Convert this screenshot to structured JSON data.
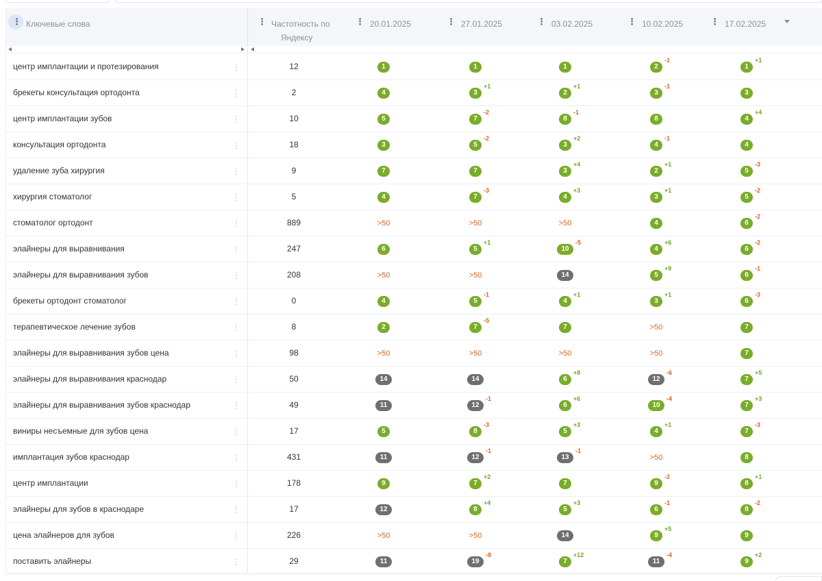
{
  "header": {
    "keywords_label": "Ключевые слова",
    "frequency_label_line1": "Частотность по",
    "frequency_label_line2": "Яндексу",
    "dates": [
      "20.01.2025",
      "27.01.2025",
      "03.02.2025",
      "10.02.2025",
      "17.02.2025"
    ]
  },
  "icons": {
    "column_menu": "vertical-dots-icon",
    "row_menu": "vertical-dots-icon",
    "sort": "caret-down-icon",
    "scroll_left": "triangle-left-icon",
    "scroll_right": "triangle-right-icon"
  },
  "colors": {
    "top_position": "#7aac2a",
    "low_position": "#6f6f6f",
    "out_of_range": "#d9631f",
    "delta_up": "#6ea52a",
    "delta_down": "#d9631f"
  },
  "rows": [
    {
      "keyword": "центр имплантации и протезирования",
      "frequency": "12",
      "positions": [
        {
          "v": "1",
          "t": "g",
          "d": ""
        },
        {
          "v": "1",
          "t": "g",
          "d": ""
        },
        {
          "v": "1",
          "t": "g",
          "d": ""
        },
        {
          "v": "2",
          "t": "g",
          "d": "-1"
        },
        {
          "v": "1",
          "t": "g",
          "d": "+1"
        }
      ]
    },
    {
      "keyword": "брекеты консультация ортодонта",
      "frequency": "2",
      "positions": [
        {
          "v": "4",
          "t": "g",
          "d": ""
        },
        {
          "v": "3",
          "t": "g",
          "d": "+1"
        },
        {
          "v": "2",
          "t": "g",
          "d": "+1"
        },
        {
          "v": "3",
          "t": "g",
          "d": "-1"
        },
        {
          "v": "3",
          "t": "g",
          "d": ""
        }
      ]
    },
    {
      "keyword": "центр имплантации зубов",
      "frequency": "10",
      "positions": [
        {
          "v": "5",
          "t": "g",
          "d": ""
        },
        {
          "v": "7",
          "t": "g",
          "d": "-2"
        },
        {
          "v": "8",
          "t": "g",
          "d": "-1"
        },
        {
          "v": "8",
          "t": "g",
          "d": ""
        },
        {
          "v": "4",
          "t": "g",
          "d": "+4"
        }
      ]
    },
    {
      "keyword": "консультация ортодонта",
      "frequency": "18",
      "positions": [
        {
          "v": "3",
          "t": "g",
          "d": ""
        },
        {
          "v": "5",
          "t": "g",
          "d": "-2"
        },
        {
          "v": "3",
          "t": "g",
          "d": "+2"
        },
        {
          "v": "4",
          "t": "g",
          "d": "-1"
        },
        {
          "v": "4",
          "t": "g",
          "d": ""
        }
      ]
    },
    {
      "keyword": "удаление зуба хирургия",
      "frequency": "9",
      "positions": [
        {
          "v": "7",
          "t": "g",
          "d": ""
        },
        {
          "v": "7",
          "t": "g",
          "d": ""
        },
        {
          "v": "3",
          "t": "g",
          "d": "+4"
        },
        {
          "v": "2",
          "t": "g",
          "d": "+1"
        },
        {
          "v": "5",
          "t": "g",
          "d": "-3"
        }
      ]
    },
    {
      "keyword": "хирургия стоматолог",
      "frequency": "5",
      "positions": [
        {
          "v": "4",
          "t": "g",
          "d": ""
        },
        {
          "v": "7",
          "t": "g",
          "d": "-3"
        },
        {
          "v": "4",
          "t": "g",
          "d": "+3"
        },
        {
          "v": "3",
          "t": "g",
          "d": "+1"
        },
        {
          "v": "5",
          "t": "g",
          "d": "-2"
        }
      ]
    },
    {
      "keyword": "стоматолог ортодонт",
      "frequency": "889",
      "positions": [
        {
          "v": ">50",
          "t": "o",
          "d": ""
        },
        {
          "v": ">50",
          "t": "o",
          "d": ""
        },
        {
          "v": ">50",
          "t": "o",
          "d": ""
        },
        {
          "v": "4",
          "t": "g",
          "d": ""
        },
        {
          "v": "6",
          "t": "g",
          "d": "-2"
        }
      ]
    },
    {
      "keyword": "элайнеры для выравнивания",
      "frequency": "247",
      "positions": [
        {
          "v": "6",
          "t": "g",
          "d": ""
        },
        {
          "v": "5",
          "t": "g",
          "d": "+1"
        },
        {
          "v": "10",
          "t": "g",
          "d": "-5"
        },
        {
          "v": "4",
          "t": "g",
          "d": "+6"
        },
        {
          "v": "6",
          "t": "g",
          "d": "-2"
        }
      ]
    },
    {
      "keyword": "элайнеры для выравнивания зубов",
      "frequency": "208",
      "positions": [
        {
          "v": ">50",
          "t": "o",
          "d": ""
        },
        {
          "v": ">50",
          "t": "o",
          "d": ""
        },
        {
          "v": "14",
          "t": "x",
          "d": ""
        },
        {
          "v": "5",
          "t": "g",
          "d": "+9"
        },
        {
          "v": "6",
          "t": "g",
          "d": "-1"
        }
      ]
    },
    {
      "keyword": "брекеты ортодонт стоматолог",
      "frequency": "0",
      "positions": [
        {
          "v": "4",
          "t": "g",
          "d": ""
        },
        {
          "v": "5",
          "t": "g",
          "d": "-1"
        },
        {
          "v": "4",
          "t": "g",
          "d": "+1"
        },
        {
          "v": "3",
          "t": "g",
          "d": "+1"
        },
        {
          "v": "6",
          "t": "g",
          "d": "-3"
        }
      ]
    },
    {
      "keyword": "терапевтическое лечение зубов",
      "frequency": "8",
      "positions": [
        {
          "v": "2",
          "t": "g",
          "d": ""
        },
        {
          "v": "7",
          "t": "g",
          "d": "-5"
        },
        {
          "v": "7",
          "t": "g",
          "d": ""
        },
        {
          "v": ">50",
          "t": "o",
          "d": ""
        },
        {
          "v": "7",
          "t": "g",
          "d": ""
        }
      ]
    },
    {
      "keyword": "элайнеры для выравнивания зубов цена",
      "frequency": "98",
      "positions": [
        {
          "v": ">50",
          "t": "o",
          "d": ""
        },
        {
          "v": ">50",
          "t": "o",
          "d": ""
        },
        {
          "v": ">50",
          "t": "o",
          "d": ""
        },
        {
          "v": ">50",
          "t": "o",
          "d": ""
        },
        {
          "v": "7",
          "t": "g",
          "d": ""
        }
      ]
    },
    {
      "keyword": "элайнеры для выравнивания краснодар",
      "frequency": "50",
      "positions": [
        {
          "v": "14",
          "t": "x",
          "d": ""
        },
        {
          "v": "14",
          "t": "x",
          "d": ""
        },
        {
          "v": "6",
          "t": "g",
          "d": "+8"
        },
        {
          "v": "12",
          "t": "x",
          "d": "-6"
        },
        {
          "v": "7",
          "t": "g",
          "d": "+5"
        }
      ]
    },
    {
      "keyword": "элайнеры для выравнивания зубов краснодар",
      "frequency": "49",
      "positions": [
        {
          "v": "11",
          "t": "x",
          "d": ""
        },
        {
          "v": "12",
          "t": "x",
          "d": "-1"
        },
        {
          "v": "6",
          "t": "g",
          "d": "+6"
        },
        {
          "v": "10",
          "t": "g",
          "d": "-4"
        },
        {
          "v": "7",
          "t": "g",
          "d": "+3"
        }
      ]
    },
    {
      "keyword": "виниры несъемные для зубов цена",
      "frequency": "17",
      "positions": [
        {
          "v": "5",
          "t": "g",
          "d": ""
        },
        {
          "v": "8",
          "t": "g",
          "d": "-3"
        },
        {
          "v": "5",
          "t": "g",
          "d": "+3"
        },
        {
          "v": "4",
          "t": "g",
          "d": "+1"
        },
        {
          "v": "7",
          "t": "g",
          "d": "-3"
        }
      ]
    },
    {
      "keyword": "имплантация зубов краснодар",
      "frequency": "431",
      "positions": [
        {
          "v": "11",
          "t": "x",
          "d": ""
        },
        {
          "v": "12",
          "t": "x",
          "d": "-1"
        },
        {
          "v": "13",
          "t": "x",
          "d": "-1"
        },
        {
          "v": ">50",
          "t": "o",
          "d": ""
        },
        {
          "v": "8",
          "t": "g",
          "d": ""
        }
      ]
    },
    {
      "keyword": "центр имплантации",
      "frequency": "178",
      "positions": [
        {
          "v": "9",
          "t": "g",
          "d": ""
        },
        {
          "v": "7",
          "t": "g",
          "d": "+2"
        },
        {
          "v": "7",
          "t": "g",
          "d": ""
        },
        {
          "v": "9",
          "t": "g",
          "d": "-2"
        },
        {
          "v": "8",
          "t": "g",
          "d": "+1"
        }
      ]
    },
    {
      "keyword": "элайнеры для зубов в краснодаре",
      "frequency": "17",
      "positions": [
        {
          "v": "12",
          "t": "x",
          "d": ""
        },
        {
          "v": "8",
          "t": "g",
          "d": "+4"
        },
        {
          "v": "5",
          "t": "g",
          "d": "+3"
        },
        {
          "v": "6",
          "t": "g",
          "d": "-1"
        },
        {
          "v": "8",
          "t": "g",
          "d": "-2"
        }
      ]
    },
    {
      "keyword": "цена элайнеров для зубов",
      "frequency": "226",
      "positions": [
        {
          "v": ">50",
          "t": "o",
          "d": ""
        },
        {
          "v": ">50",
          "t": "o",
          "d": ""
        },
        {
          "v": "14",
          "t": "x",
          "d": ""
        },
        {
          "v": "9",
          "t": "g",
          "d": "+5"
        },
        {
          "v": "9",
          "t": "g",
          "d": ""
        }
      ]
    },
    {
      "keyword": "поставить элайнеры",
      "frequency": "29",
      "positions": [
        {
          "v": "11",
          "t": "x",
          "d": ""
        },
        {
          "v": "19",
          "t": "x",
          "d": "-8"
        },
        {
          "v": "7",
          "t": "g",
          "d": "+12"
        },
        {
          "v": "11",
          "t": "x",
          "d": "-4"
        },
        {
          "v": "9",
          "t": "g",
          "d": "+2"
        }
      ]
    }
  ]
}
